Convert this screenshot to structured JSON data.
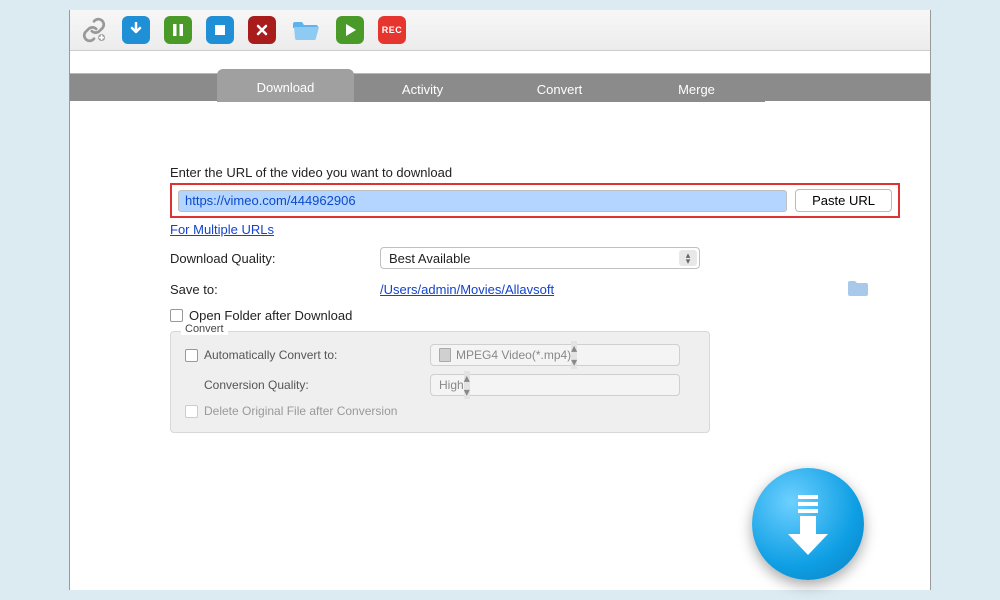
{
  "toolbar": {
    "items": [
      {
        "name": "link-icon"
      },
      {
        "name": "download-icon"
      },
      {
        "name": "pause-icon"
      },
      {
        "name": "stop-icon"
      },
      {
        "name": "delete-icon"
      },
      {
        "name": "open-folder-icon"
      },
      {
        "name": "play-icon"
      },
      {
        "name": "record-icon",
        "label": "REC"
      }
    ]
  },
  "tabs": [
    {
      "label": "Download",
      "active": true
    },
    {
      "label": "Activity",
      "active": false
    },
    {
      "label": "Convert",
      "active": false
    },
    {
      "label": "Merge",
      "active": false
    }
  ],
  "main": {
    "url_prompt": "Enter the URL of the video you want to download",
    "url_value": "https://vimeo.com/444962906",
    "paste_label": "Paste URL",
    "multiple_link": "For Multiple URLs",
    "quality_label": "Download Quality:",
    "quality_value": "Best Available",
    "save_label": "Save to:",
    "save_path": "/Users/admin/Movies/Allavsoft",
    "open_folder_label": "Open Folder after Download"
  },
  "convert": {
    "legend": "Convert",
    "auto_label": "Automatically Convert to:",
    "format_value": "MPEG4 Video(*.mp4)",
    "quality_label": "Conversion Quality:",
    "quality_value": "High",
    "delete_label": "Delete Original File after Conversion"
  }
}
